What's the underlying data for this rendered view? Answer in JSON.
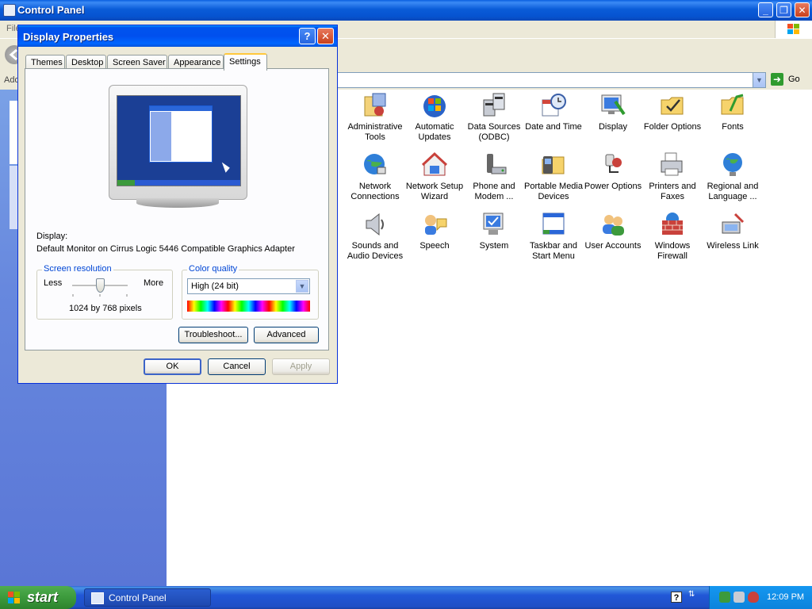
{
  "window": {
    "title": "Control Panel"
  },
  "menu": {
    "first_item": "File"
  },
  "address": {
    "label": "Address",
    "go_label": "Go"
  },
  "control_panel_items": [
    {
      "label_line1": "Administrative",
      "label_line2": "Tools",
      "icon": "administrative-tools-icon"
    },
    {
      "label_line1": "Automatic",
      "label_line2": "Updates",
      "icon": "automatic-updates-icon"
    },
    {
      "label_line1": "Data Sources",
      "label_line2": "(ODBC)",
      "icon": "data-sources-icon"
    },
    {
      "label_line1": "Date and Time",
      "label_line2": "",
      "icon": "date-time-icon"
    },
    {
      "label_line1": "Display",
      "label_line2": "",
      "icon": "display-icon"
    },
    {
      "label_line1": "Folder Options",
      "label_line2": "",
      "icon": "folder-options-icon"
    },
    {
      "label_line1": "Fonts",
      "label_line2": "",
      "icon": "fonts-icon"
    },
    {
      "label_line1": "Network",
      "label_line2": "Connections",
      "icon": "network-connections-icon"
    },
    {
      "label_line1": "Network Setup",
      "label_line2": "Wizard",
      "icon": "network-setup-icon"
    },
    {
      "label_line1": "Phone and",
      "label_line2": "Modem ...",
      "icon": "phone-modem-icon"
    },
    {
      "label_line1": "Portable Media",
      "label_line2": "Devices",
      "icon": "portable-media-icon"
    },
    {
      "label_line1": "Power Options",
      "label_line2": "",
      "icon": "power-options-icon"
    },
    {
      "label_line1": "Printers and",
      "label_line2": "Faxes",
      "icon": "printers-faxes-icon"
    },
    {
      "label_line1": "Regional and",
      "label_line2": "Language ...",
      "icon": "regional-language-icon"
    },
    {
      "label_line1": "Sounds and",
      "label_line2": "Audio Devices",
      "icon": "sounds-audio-icon"
    },
    {
      "label_line1": "Speech",
      "label_line2": "",
      "icon": "speech-icon"
    },
    {
      "label_line1": "System",
      "label_line2": "",
      "icon": "system-icon"
    },
    {
      "label_line1": "Taskbar and",
      "label_line2": "Start Menu",
      "icon": "taskbar-start-icon"
    },
    {
      "label_line1": "User Accounts",
      "label_line2": "",
      "icon": "user-accounts-icon"
    },
    {
      "label_line1": "Windows",
      "label_line2": "Firewall",
      "icon": "firewall-icon"
    },
    {
      "label_line1": "Wireless Link",
      "label_line2": "",
      "icon": "wireless-link-icon"
    }
  ],
  "dialog": {
    "title": "Display Properties",
    "help_label": "?",
    "tabs": [
      "Themes",
      "Desktop",
      "Screen Saver",
      "Appearance",
      "Settings"
    ],
    "active_tab": "Settings",
    "display_label": "Display:",
    "display_value": "Default Monitor on Cirrus Logic 5446 Compatible Graphics Adapter",
    "resolution": {
      "title": "Screen resolution",
      "less_label": "Less",
      "more_label": "More",
      "value": "1024 by 768 pixels",
      "slider_position": 0.5
    },
    "color_quality": {
      "title": "Color quality",
      "selected": "High (24 bit)"
    },
    "buttons": {
      "troubleshoot": "Troubleshoot...",
      "advanced": "Advanced",
      "ok": "OK",
      "cancel": "Cancel",
      "apply": "Apply"
    }
  },
  "taskbar": {
    "start_label": "start",
    "task_button_label": "Control Panel",
    "clock": "12:09 PM"
  },
  "colors": {
    "title_blue": "#0053ee",
    "taskbar_blue": "#245edb",
    "start_green": "#3c9a3c",
    "tray_blue": "#0f8ee6",
    "left_panel_blue": "#6788de"
  }
}
